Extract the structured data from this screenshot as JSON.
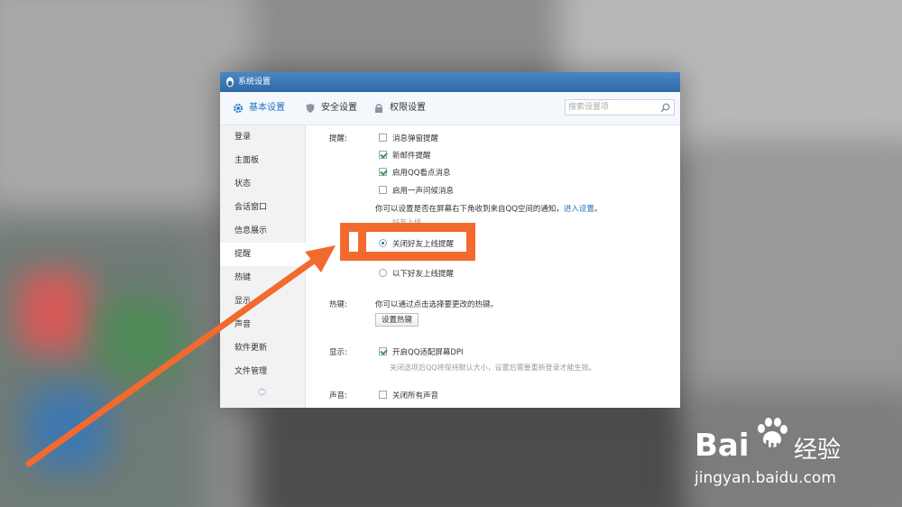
{
  "window": {
    "title": "系统设置"
  },
  "tabs": [
    {
      "label": "基本设置",
      "icon": "gear-icon"
    },
    {
      "label": "安全设置",
      "icon": "shield-icon"
    },
    {
      "label": "权限设置",
      "icon": "lock-icon"
    }
  ],
  "search": {
    "placeholder": "搜索设置项"
  },
  "sidebar": {
    "items": [
      {
        "label": "登录"
      },
      {
        "label": "主面板"
      },
      {
        "label": "状态"
      },
      {
        "label": "会话窗口"
      },
      {
        "label": "信息展示"
      },
      {
        "label": "提醒"
      },
      {
        "label": "热键"
      },
      {
        "label": "显示"
      },
      {
        "label": "声音"
      },
      {
        "label": "软件更新"
      },
      {
        "label": "文件管理"
      }
    ],
    "active": "提醒"
  },
  "reminder": {
    "section_label": "提醒:",
    "options": [
      {
        "label": "消息弹窗提醒",
        "checked": false
      },
      {
        "label": "新邮件提醒",
        "checked": true
      },
      {
        "label": "启用QQ看点消息",
        "checked": true
      },
      {
        "label": "启用一声问候消息",
        "checked": false
      }
    ],
    "note_prefix": "你可以设置是否在屏幕右下角收到来自QQ空间的通知，",
    "note_link": "进入设置",
    "note_suffix": "。",
    "partial_heading": "好友上线",
    "friend_options": [
      {
        "label": "关闭好友上线提醒",
        "selected": true
      },
      {
        "label": "以下好友上线提醒",
        "selected": false
      }
    ]
  },
  "hotkey": {
    "section_label": "热键:",
    "desc": "你可以通过点击选择要更改的热键。",
    "button_label": "设置热键"
  },
  "display": {
    "section_label": "显示:",
    "option_label": "开启QQ适配屏幕DPI",
    "checked": true,
    "hint": "关闭选项后QQ将保持默认大小，设置后需要重新登录才能生效。"
  },
  "sound": {
    "section_label": "声音:",
    "option_label": "关闭所有声音",
    "checked": false
  },
  "watermark": {
    "brand": "Bai",
    "brand_suffix": "du",
    "cn": "经验",
    "url": "jingyan.baidu.com"
  },
  "colors": {
    "accent": "#1f6fc2",
    "annotation": "#f26a2e",
    "check": "#3a9a3a"
  }
}
